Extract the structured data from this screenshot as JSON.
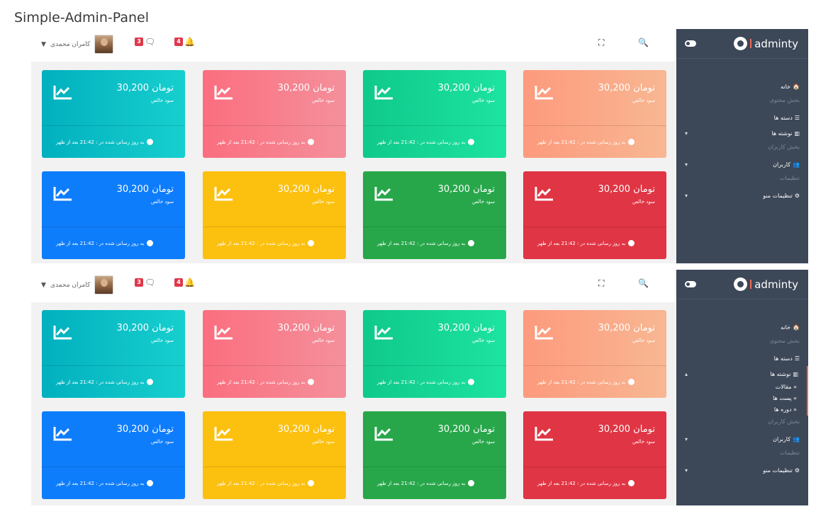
{
  "page": {
    "title": "Simple-Admin-Panel"
  },
  "header": {
    "user_name": "کامران محمدی",
    "messages_badge": "3",
    "notifications_badge": "4",
    "icons": [
      "chevron-down-icon",
      "avatar",
      "message-icon",
      "bell-icon",
      "fullscreen-icon",
      "search-icon"
    ]
  },
  "sidebar": {
    "logo_text": "adminty",
    "menu_a": {
      "home": "خانه",
      "section_content": "بخش محتوی",
      "categories": "دسته ها",
      "posts": "نوشته ها",
      "section_users": "بخش کاربران",
      "users": "کاربران",
      "section_settings": "تنظیمات",
      "menu_settings": "تنظیمات منو"
    },
    "submenu": [
      "مقالات",
      "پست ها",
      "دوره ها"
    ]
  },
  "card_text": {
    "amount": "30,200 تومان",
    "subtitle": "سود خالص",
    "footer": "به روز رسانی شده در : 21:42 بعد از ظهر"
  },
  "card_colors": {
    "orange": "#fd9a7d",
    "green_light": "#0fc98b",
    "pink": "#fb6e7f",
    "cyan": "#01b0be",
    "red": "#e03544",
    "green": "#27a74a",
    "yellow": "#fcc00e",
    "blue": "#0e7dfb"
  },
  "accent": "#f06c52",
  "sidebar_bg": "#3c4758"
}
